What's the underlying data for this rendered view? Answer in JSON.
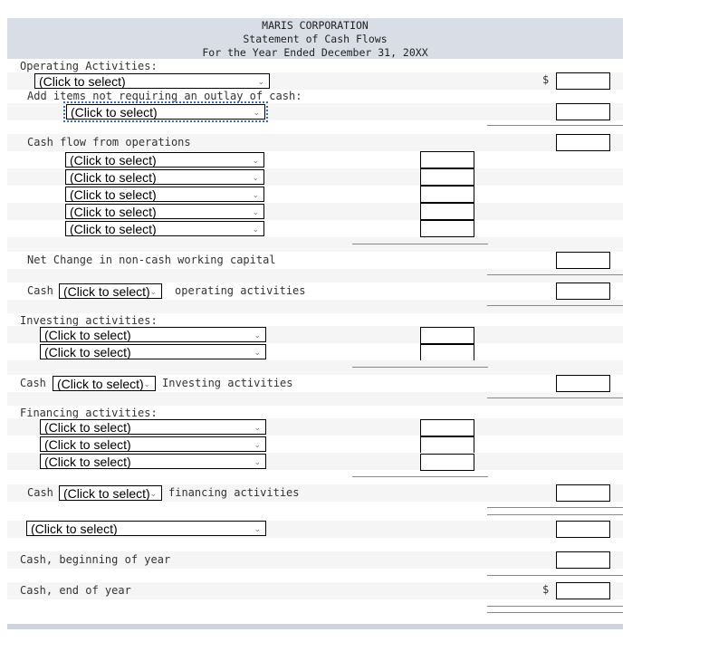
{
  "header": {
    "company": "MARIS CORPORATION",
    "statement": "Statement of Cash Flows",
    "period": "For the Year Ended December 31, 20XX"
  },
  "placeholder": "(Click to select)",
  "currency": "$",
  "operating": {
    "title": "Operating Activities:",
    "add_items": "Add items not requiring an outlay of cash:",
    "cash_flow_ops": "Cash flow from operations",
    "net_change": "Net Change in non-cash working capital",
    "cash_label": "Cash",
    "cash_suffix": "operating activities"
  },
  "investing": {
    "title": "Investing activities:",
    "cash_label": "Cash",
    "cash_suffix": "Investing activities"
  },
  "financing": {
    "title": "Financing activities:",
    "cash_label": "Cash",
    "cash_suffix": "financing activities"
  },
  "totals": {
    "beginning": "Cash, beginning of year",
    "end": "Cash, end of year"
  }
}
